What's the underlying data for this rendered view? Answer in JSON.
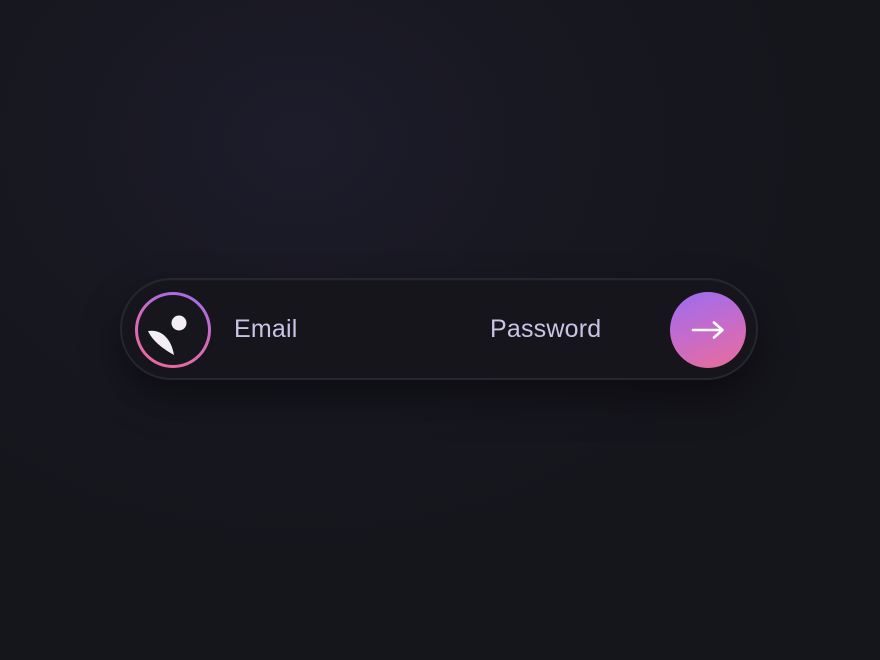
{
  "login": {
    "email_placeholder": "Email",
    "password_placeholder": "Password",
    "submit_icon": "arrow-right-icon",
    "avatar_icon": "user-logo-icon"
  },
  "colors": {
    "background": "#17171f",
    "bar": "#15151b",
    "bar_border": "#26262e",
    "text": "#c9c3e6",
    "accent_start": "#9b6cf2",
    "accent_end": "#ea6c98"
  }
}
